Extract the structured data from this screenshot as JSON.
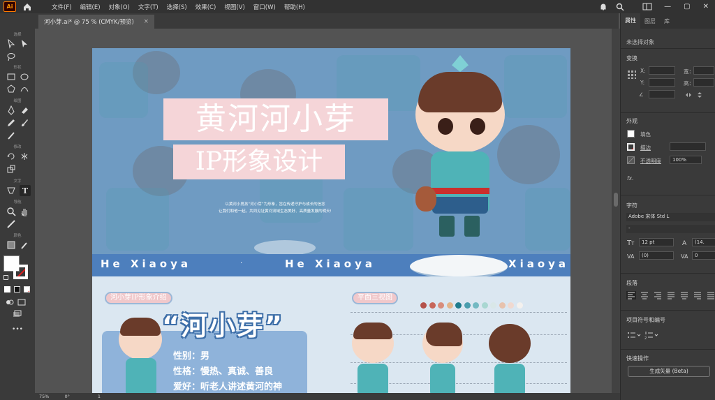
{
  "app": {
    "logo": "Ai",
    "accent": "#ff9a00"
  },
  "menu": [
    "文件(F)",
    "编辑(E)",
    "对象(O)",
    "文字(T)",
    "选择(S)",
    "效果(C)",
    "视图(V)",
    "窗口(W)",
    "帮助(H)"
  ],
  "window_controls": [
    "—",
    "▢",
    "✕"
  ],
  "doc_tab": {
    "title": "河小芽.ai* @ 75 % (CMYK/预览)",
    "close": "×"
  },
  "toolbar": {
    "groups": [
      "选择",
      "形状",
      "绘图",
      "修改",
      "文字",
      "导航",
      "颜色"
    ],
    "more": "•••"
  },
  "artwork": {
    "title_line1": "黄河河小芽",
    "title_line2": "IP形象设计",
    "slogan_line1": "以黄河小男孩“河小芽”为形象，旨在传递守护与成长的信念",
    "slogan_line2": "让我们和他一起，共同见证黄河流域生态美好、高质量发展的明天!",
    "strip_left": "He Xiaoya",
    "strip_dot": "·",
    "strip_mid": "He Xiaoya",
    "strip_right": "Xiaoya",
    "intro_label": "河小芽IP形象介绍",
    "views_label": "平面三视图",
    "big_name": "“河小芽”",
    "info": [
      "性别：男",
      "性格：慢热、真诚、善良",
      "爱好：听老人讲述黄河的神"
    ],
    "palette": [
      "#b5524b",
      "#c7675b",
      "#d88d7c",
      "#e3b48a",
      "#1f7c8d",
      "#4a9eae",
      "#73b9c2",
      "#a9d7d2",
      "#d9e7e8",
      "#e7c2ad",
      "#f0d9d0",
      "#f4f1ee"
    ],
    "colors": {
      "banner": "#6f9bc2",
      "strip": "#4d7fbd",
      "title_bg": "#f5d5d8",
      "lower_bg": "#dbe7f1"
    }
  },
  "panel": {
    "tabs": [
      "属性",
      "图层",
      "库"
    ],
    "no_selection": "未选择对象",
    "transform": {
      "title": "变换",
      "x": "X:",
      "y": "Y:",
      "w": "宽：",
      "h": "高：",
      "angle": "∠"
    },
    "appearance": {
      "title": "外观",
      "fill": "填色",
      "stroke": "描边",
      "opacity": "不透明度",
      "opacity_value": "100%",
      "fx": "fx."
    },
    "character": {
      "title": "字符",
      "font": "Adobe 宋体 Std L",
      "style": "-",
      "size": "12 pt",
      "leading": "(14.",
      "kerning": "(0)",
      "tracking": "0"
    },
    "paragraph": {
      "title": "段落"
    },
    "bullets": {
      "title": "项目符号和编号"
    },
    "quick": {
      "title": "快速操作",
      "button": "生成矢量 (Beta)"
    }
  },
  "status": {
    "zoom": "75%",
    "rotate": "0°",
    "artboard": "1"
  }
}
